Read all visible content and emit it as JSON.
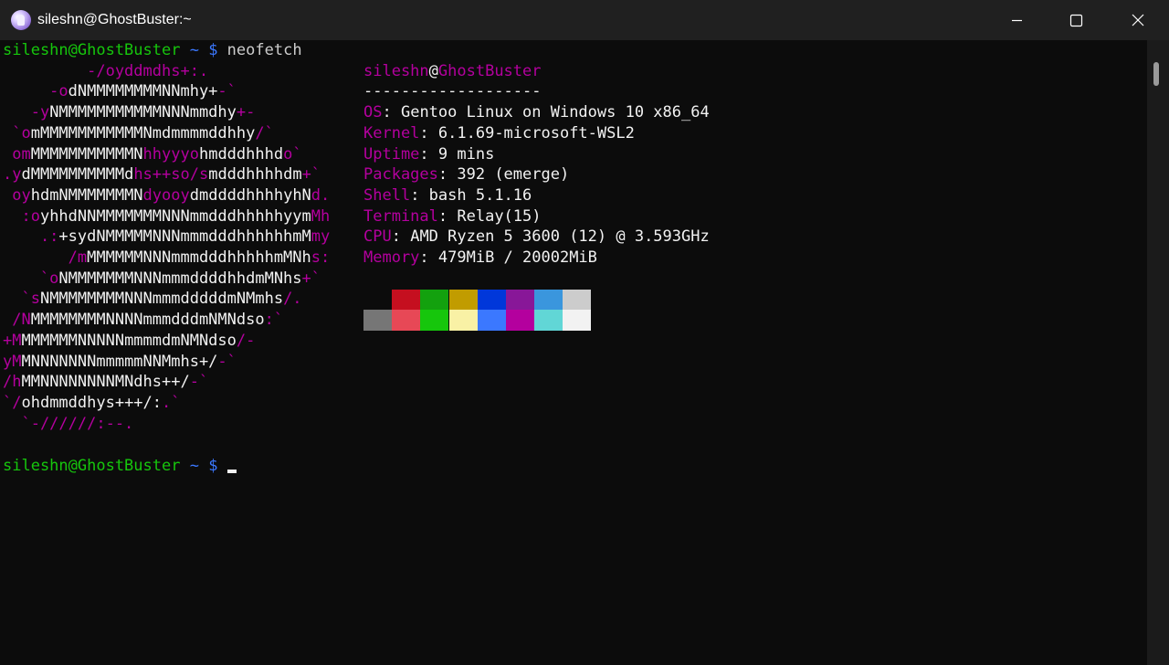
{
  "window": {
    "title": "sileshn@GhostBuster:~"
  },
  "terminal": {
    "prompt": {
      "user_host": "sileshn@GhostBuster",
      "path": " ~ ",
      "symbol": "$"
    },
    "command": " neofetch",
    "logo_lines": [
      [
        {
          "c": "m",
          "t": "         -/oyddmdhs+:."
        }
      ],
      [
        {
          "c": "m",
          "t": "     -o"
        },
        {
          "c": "w",
          "t": "dNMMMMMMMMNNmhy+"
        },
        {
          "c": "m",
          "t": "-`"
        }
      ],
      [
        {
          "c": "m",
          "t": "   -y"
        },
        {
          "c": "w",
          "t": "NMMMMMMMMMMMNNNmmdhy"
        },
        {
          "c": "m",
          "t": "+-"
        }
      ],
      [
        {
          "c": "m",
          "t": " `o"
        },
        {
          "c": "w",
          "t": "mMMMMMMMMMMMNmdmmmmddhhy"
        },
        {
          "c": "m",
          "t": "/`"
        }
      ],
      [
        {
          "c": "m",
          "t": " om"
        },
        {
          "c": "w",
          "t": "MMMMMMMMMMMN"
        },
        {
          "c": "m",
          "t": "hhyyyo"
        },
        {
          "c": "w",
          "t": "hmdddhhhd"
        },
        {
          "c": "m",
          "t": "o`"
        }
      ],
      [
        {
          "c": "m",
          "t": ".y"
        },
        {
          "c": "w",
          "t": "dMMMMMMMMMMd"
        },
        {
          "c": "m",
          "t": "hs++so/s"
        },
        {
          "c": "w",
          "t": "mdddhhhhdm"
        },
        {
          "c": "m",
          "t": "+`"
        }
      ],
      [
        {
          "c": "m",
          "t": " oy"
        },
        {
          "c": "w",
          "t": "hdmNMMMMMMMN"
        },
        {
          "c": "m",
          "t": "dyooy"
        },
        {
          "c": "w",
          "t": "dmddddhhhhyhN"
        },
        {
          "c": "m",
          "t": "d."
        }
      ],
      [
        {
          "c": "m",
          "t": "  :o"
        },
        {
          "c": "w",
          "t": "yhhdNNMMMMMMMNNNmmdddhhhhhyym"
        },
        {
          "c": "m",
          "t": "Mh"
        }
      ],
      [
        {
          "c": "m",
          "t": "    .:"
        },
        {
          "c": "w",
          "t": "+sydNMMMMMNNNmmmdddhhhhhhmM"
        },
        {
          "c": "m",
          "t": "my"
        }
      ],
      [
        {
          "c": "m",
          "t": "       /m"
        },
        {
          "c": "w",
          "t": "MMMMMMNNNmmmdddhhhhhmMNh"
        },
        {
          "c": "m",
          "t": "s:"
        }
      ],
      [
        {
          "c": "m",
          "t": "    `o"
        },
        {
          "c": "w",
          "t": "NMMMMMMMNNNmmmddddhhdmMNhs"
        },
        {
          "c": "m",
          "t": "+`"
        }
      ],
      [
        {
          "c": "m",
          "t": "  `s"
        },
        {
          "c": "w",
          "t": "NMMMMMMMMNNNmmmdddddmNMmhs"
        },
        {
          "c": "m",
          "t": "/."
        }
      ],
      [
        {
          "c": "m",
          "t": " /N"
        },
        {
          "c": "w",
          "t": "MMMMMMMMNNNNmmmdddmNMNdso"
        },
        {
          "c": "m",
          "t": ":`"
        }
      ],
      [
        {
          "c": "m",
          "t": "+M"
        },
        {
          "c": "w",
          "t": "MMMMMMNNNNNmmmmdmNMNdso"
        },
        {
          "c": "m",
          "t": "/-"
        }
      ],
      [
        {
          "c": "m",
          "t": "yM"
        },
        {
          "c": "w",
          "t": "MNNNNNNNmmmmmNNMmhs+/"
        },
        {
          "c": "m",
          "t": "-`"
        }
      ],
      [
        {
          "c": "m",
          "t": "/h"
        },
        {
          "c": "w",
          "t": "MMNNNNNNNNMNdhs++/"
        },
        {
          "c": "m",
          "t": "-`"
        }
      ],
      [
        {
          "c": "m",
          "t": "`/"
        },
        {
          "c": "w",
          "t": "ohdmmddhys+++/:"
        },
        {
          "c": "m",
          "t": ".`"
        }
      ],
      [
        {
          "c": "m",
          "t": "  `-//////:--."
        }
      ]
    ],
    "info": {
      "user": "sileshn",
      "at": "@",
      "host": "GhostBuster",
      "separator": "-------------------",
      "fields": [
        {
          "key": "OS",
          "value": "Gentoo Linux on Windows 10 x86_64"
        },
        {
          "key": "Kernel",
          "value": "6.1.69-microsoft-WSL2"
        },
        {
          "key": "Uptime",
          "value": "9 mins"
        },
        {
          "key": "Packages",
          "value": "392 (emerge)"
        },
        {
          "key": "Shell",
          "value": "bash 5.1.16"
        },
        {
          "key": "Terminal",
          "value": "Relay(15)"
        },
        {
          "key": "CPU",
          "value": "AMD Ryzen 5 3600 (12) @ 3.593GHz"
        },
        {
          "key": "Memory",
          "value": "479MiB / 20002MiB"
        }
      ]
    },
    "palette": {
      "row1": [
        "#0c0c0c",
        "#c50f1f",
        "#13a10e",
        "#c19c00",
        "#0037da",
        "#881798",
        "#3a96dd",
        "#cccccc"
      ],
      "row2": [
        "#767676",
        "#e74856",
        "#16c60c",
        "#f9f1a5",
        "#3b78ff",
        "#b4009e",
        "#61d6d6",
        "#f2f2f2"
      ]
    }
  }
}
